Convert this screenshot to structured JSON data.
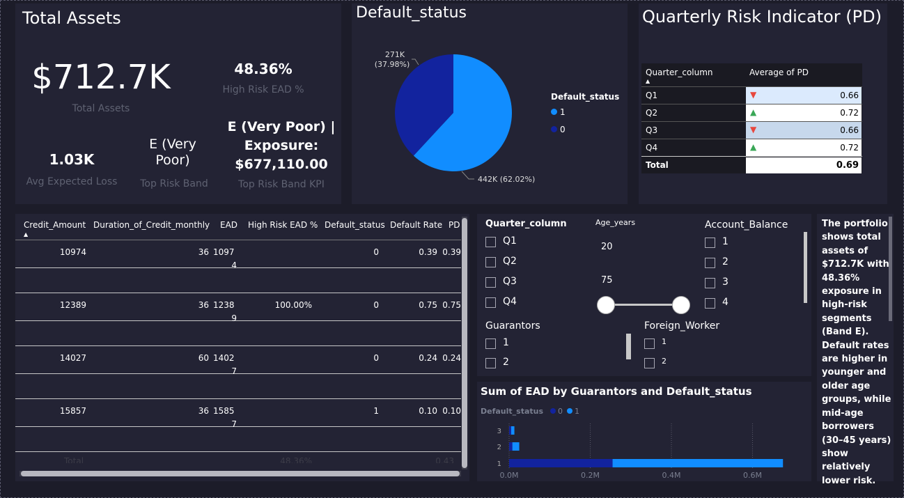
{
  "kpi": {
    "title": "Total Assets",
    "total_value": "$712.7K",
    "total_label": "Total Assets",
    "high_risk_value": "48.36%",
    "high_risk_label": "High Risk EAD %",
    "avg_loss_value": "1.03K",
    "avg_loss_label": "Avg Expected Loss",
    "band_value": "E (Very Poor)",
    "band_label": "Top Risk Band",
    "band_kpi_value": "E (Very Poor) | Exposure: $677,110.00",
    "band_kpi_label": "Top Risk Band KPI"
  },
  "pie": {
    "title": "Default_status",
    "legend_title": "Default_status",
    "legend": [
      {
        "label": "1",
        "color": "#118dff"
      },
      {
        "label": "0",
        "color": "#12239e"
      }
    ],
    "label_small_line1": "271K",
    "label_small_line2": "(37.98%)",
    "label_large": "442K (62.02%)"
  },
  "quarterly": {
    "title": "Quarterly Risk Indicator (PD)",
    "col1": "Quarter_column",
    "col2": "Average of PD",
    "rows": [
      {
        "q": "Q1",
        "v": "0.66",
        "trend": "down"
      },
      {
        "q": "Q2",
        "v": "0.72",
        "trend": "up"
      },
      {
        "q": "Q3",
        "v": "0.66",
        "trend": "down"
      },
      {
        "q": "Q4",
        "v": "0.72",
        "trend": "up"
      }
    ],
    "total_label": "Total",
    "total_value": "0.69"
  },
  "table": {
    "headers": [
      "Credit_Amount",
      "Duration_of_Credit_monthly",
      "EAD",
      "High Risk EAD %",
      "Default_status",
      "Default Rate",
      "PD"
    ],
    "rows": [
      {
        "credit": "10974",
        "dur": "36",
        "ead1": "1097",
        "ead2": "4",
        "hr": "",
        "ds": "0",
        "dr": "0.39",
        "pd": "0.39"
      },
      {
        "credit": "12389",
        "dur": "36",
        "ead1": "1238",
        "ead2": "9",
        "hr": "100.00%",
        "ds": "0",
        "dr": "0.75",
        "pd": "0.75"
      },
      {
        "credit": "14027",
        "dur": "60",
        "ead1": "1402",
        "ead2": "7",
        "hr": "",
        "ds": "0",
        "dr": "0.24",
        "pd": "0.24"
      },
      {
        "credit": "15857",
        "dur": "36",
        "ead1": "1585",
        "ead2": "7",
        "hr": "",
        "ds": "1",
        "dr": "0.10",
        "pd": "0.10"
      }
    ],
    "total_label": "Total",
    "total_hr": "48.36%",
    "total_dr": "0.43"
  },
  "filters": {
    "quarter_title": "Quarter_column",
    "quarters": [
      "Q1",
      "Q2",
      "Q3",
      "Q4"
    ],
    "age_title": "Age_years",
    "age_min": "20",
    "age_max": "75",
    "balance_title": "Account_Balance",
    "balances": [
      "1",
      "2",
      "3",
      "4"
    ],
    "guarantors_title": "Guarantors",
    "guarantors": [
      "1",
      "2"
    ],
    "foreign_title": "Foreign_Worker",
    "foreign": [
      "1",
      "2"
    ]
  },
  "bar": {
    "title": "Sum of EAD by Guarantors and Default_status",
    "legend_title": "Default_status",
    "legend_0": "0",
    "legend_1": "1"
  },
  "chart_data": {
    "type": "bar",
    "orientation": "horizontal",
    "stacked": true,
    "title": "Sum of EAD by Guarantors and Default_status",
    "categories": [
      "3",
      "2",
      "1"
    ],
    "series": [
      {
        "name": "0",
        "color": "#12239e",
        "values": [
          0.005,
          0.008,
          0.255
        ]
      },
      {
        "name": "1",
        "color": "#118dff",
        "values": [
          0.008,
          0.017,
          0.42
        ]
      }
    ],
    "x_ticks": [
      "0.0M",
      "0.2M",
      "0.4M",
      "0.6M"
    ],
    "xlim": [
      0,
      0.7
    ],
    "legend_placement": "top-left"
  },
  "narrative": {
    "lines": [
      "The portfolio",
      "shows total",
      "assets of",
      "$712.7K with",
      "48.36%",
      "exposure in",
      "high-risk",
      "segments",
      "(Band E).",
      "Default rates",
      "are higher in",
      "younger and",
      "older age",
      "groups, while",
      "mid-age",
      "borrowers",
      "(30–45 years)",
      "show",
      "relatively",
      "lower risk."
    ]
  }
}
